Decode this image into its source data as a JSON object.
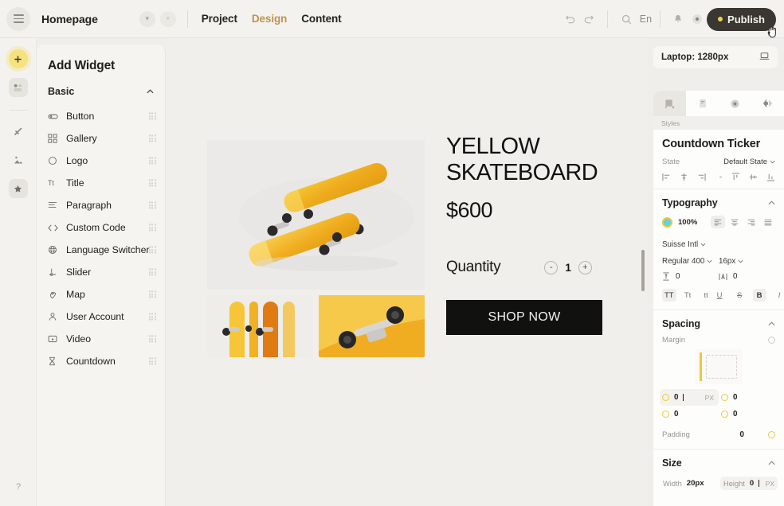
{
  "topbar": {
    "page_name": "Homepage",
    "nav_tabs": [
      {
        "label": "Project",
        "active": false
      },
      {
        "label": "Design",
        "active": true
      },
      {
        "label": "Content",
        "active": false
      }
    ],
    "language": "En",
    "publish_label": "Publish",
    "accent_color": "#c0934f",
    "publish_bg": "#3a3631",
    "publish_dot_color": "#f2cf4a"
  },
  "rail": {
    "help_label": "?"
  },
  "widgets": {
    "title": "Add Widget",
    "section": "Basic",
    "items": [
      {
        "label": "Button",
        "icon": "button-icon"
      },
      {
        "label": "Gallery",
        "icon": "gallery-icon"
      },
      {
        "label": "Logo",
        "icon": "logo-icon"
      },
      {
        "label": "Title",
        "icon": "title-icon"
      },
      {
        "label": "Paragraph",
        "icon": "paragraph-icon"
      },
      {
        "label": "Custom Code",
        "icon": "code-icon"
      },
      {
        "label": "Language Switcher",
        "icon": "globe-icon"
      },
      {
        "label": "Slider",
        "icon": "slider-icon"
      },
      {
        "label": "Map",
        "icon": "map-pin-icon"
      },
      {
        "label": "User Account",
        "icon": "user-icon"
      },
      {
        "label": "Video",
        "icon": "video-icon"
      },
      {
        "label": "Countdown",
        "icon": "hourglass-icon"
      }
    ]
  },
  "canvas": {
    "product_title": "YELLOW SKATEBOARD",
    "price": "$600",
    "quantity_label": "Quantity",
    "quantity_value": "1",
    "decrement_label": "-",
    "increment_label": "+",
    "cta_label": "SHOP NOW"
  },
  "inspector": {
    "device_label": "Laptop: 1280px",
    "tabs_caption": "Styles",
    "element_title": "Countdown Ticker",
    "state_label": "State",
    "state_value": "Default State",
    "typography": {
      "heading": "Typography",
      "opacity": "100%",
      "color_swatch": "#5fd4e0",
      "color_ring": "#ecc93c",
      "font_family": "Suisse Intl",
      "font_weight": "Regular 400",
      "font_size": "16px",
      "line_height": "0",
      "letter_spacing": "0",
      "transform_options": [
        "TT",
        "Tt",
        "tt"
      ],
      "transform_active": "TT",
      "decoration_options": [
        "U",
        "S",
        "B",
        "I"
      ],
      "decoration_active": "B"
    },
    "spacing": {
      "heading": "Spacing",
      "margin_label": "Margin",
      "margin_top": "0",
      "margin_right": "0",
      "margin_bottom": "0",
      "margin_left": "0",
      "margin_unit": "PX",
      "padding_label": "Padding",
      "padding_value": "0"
    },
    "size": {
      "heading": "Size",
      "width_label": "Width",
      "width_value": "20px",
      "height_label": "Height",
      "height_value": "0",
      "height_unit": "PX"
    }
  }
}
